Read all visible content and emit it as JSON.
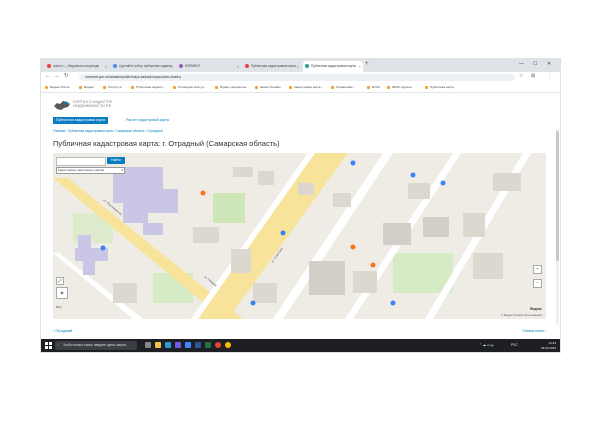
{
  "browser": {
    "tabs": [
      {
        "label": "xumi.ru — Ведомость переходн",
        "color": "#e8433a"
      },
      {
        "label": "Сделайте отбор публичных кадастр",
        "color": "#4c8bf5"
      },
      {
        "label": "ЕЛЕМЕНТ",
        "color": "#9b59b6"
      },
      {
        "label": "Публичная кадастровая карта",
        "color": "#e8433a"
      },
      {
        "label": "Публичная кадастровая карта",
        "color": "#2a9d8f"
      }
    ],
    "new_tab": "+",
    "url": "rosreestr.gov.ru/cadastre/publichnaya-kadastrovaya-karta-otradny",
    "bookmarks": [
      "Яндекс.Почта",
      "Яндекс",
      "Госуслуги",
      "Публичная кадастр...",
      "Госзакупки Контур...",
      "Подать документы...",
      "Земля Онлайн",
      "Кадастровая карта...",
      "Справочник...",
      "ЕГРН",
      "ФИАС Адреса",
      "Публичная карта"
    ]
  },
  "site": {
    "logo_text_line1": "ПОРТАЛ О КАДАСТРЕ",
    "logo_text_line2": "НЕДВИЖИМОСТИ РФ",
    "nav_active": "Публичная кадастровая карта",
    "nav_link": "Расчет кадастровой карты",
    "breadcrumb": "Главная  ›  Публичная кадастровая карта  ›  Самарская область  ›  Отрадный",
    "title": "Публичная кадастровая карта: г. Отрадный (Самарская область)"
  },
  "map": {
    "search_value": "63:04:0000000:1115",
    "search_button": "Найти",
    "layer_select": "Кадастровые земельные участки",
    "zoom_in": "+",
    "zoom_out": "−",
    "scale_label": "50 м",
    "brand": "Яндекс",
    "attribution": "© Яндекс Условия использования",
    "street_1": "ул. Первомайская",
    "street_2": "ул. Советская",
    "street_3": "ул. Гайдара"
  },
  "pager": {
    "prev": "‹ Отрадный",
    "next": "Похвистнево ›"
  },
  "taskbar": {
    "search_placeholder": "Чтобы начать поиск, введите здесь запрос",
    "tray": "РУС",
    "time": "14:43",
    "date": "03.03.2023"
  }
}
